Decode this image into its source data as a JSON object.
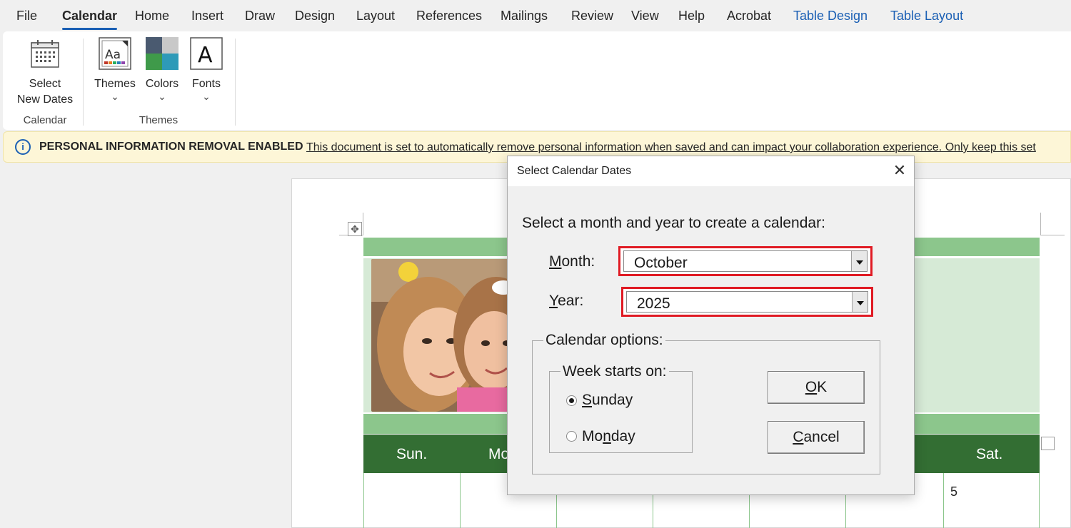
{
  "menu": {
    "tabs": [
      "File",
      "Calendar",
      "Home",
      "Insert",
      "Draw",
      "Design",
      "Layout",
      "References",
      "Mailings",
      "Review",
      "View",
      "Help",
      "Acrobat",
      "Table Design",
      "Table Layout"
    ],
    "active_tab": "Calendar"
  },
  "ribbon": {
    "select_dates_line1": "Select",
    "select_dates_line2": "New Dates",
    "themes_label": "Themes",
    "colors_label": "Colors",
    "fonts_label": "Fonts",
    "chevron": "⌄",
    "group_calendar": "Calendar",
    "group_themes": "Themes"
  },
  "infobar": {
    "title": "PERSONAL INFORMATION REMOVAL ENABLED",
    "message": "This document is set to automatically remove personal information when saved and can impact your collaboration experience. Only keep this set"
  },
  "document": {
    "days": [
      "Sun.",
      "Mo",
      "Sat."
    ],
    "visible_date": "5"
  },
  "dialog": {
    "title": "Select Calendar Dates",
    "close": "✕",
    "prompt": "Select a month and year to create a calendar:",
    "month_label_key": "M",
    "month_label_rest": "onth:",
    "month_value": "October",
    "year_label_key": "Y",
    "year_label_rest": "ear:",
    "year_value": "2025",
    "options_legend": "Calendar options:",
    "week_legend": "Week starts on:",
    "sunday_key": "S",
    "sunday_rest": "unday",
    "monday_pre": "Mo",
    "monday_key": "n",
    "monday_rest": "day",
    "selected_week_start": "Sunday",
    "ok_key": "O",
    "ok_rest": "K",
    "cancel_key": "C",
    "cancel_rest": "ancel"
  },
  "colors": {
    "accent": "#1a5fb4",
    "highlight": "#e01b24",
    "calendar_dark_green": "#336e33",
    "calendar_light_green": "#8cc68c"
  }
}
